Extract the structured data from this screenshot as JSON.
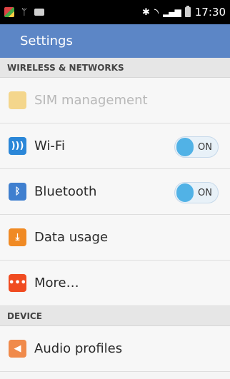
{
  "status": {
    "time": "17:30",
    "icons": [
      "app-icon",
      "usb-icon",
      "message-icon",
      "bluetooth-icon",
      "wifi-icon",
      "signal-icon",
      "battery-icon"
    ]
  },
  "header": {
    "title": "Settings"
  },
  "sections": {
    "wireless": "WIRELESS & NETWORKS",
    "device": "DEVICE"
  },
  "rows": {
    "sim": "SIM management",
    "wifi": {
      "label": "Wi-Fi",
      "toggle": "ON"
    },
    "bluetooth": {
      "label": "Bluetooth",
      "toggle": "ON"
    },
    "data": "Data usage",
    "more": "More…",
    "audio": "Audio profiles"
  },
  "colors": {
    "header_bg": "#5c86c6",
    "toggle_on": "#51b2e6",
    "wifi_icon": "#2b87d8",
    "bluetooth_icon": "#3f7fcf",
    "data_icon": "#f08a24",
    "more_icon": "#f04b20",
    "audio_icon": "#f08a4b",
    "sim_icon": "#f4d68c"
  }
}
